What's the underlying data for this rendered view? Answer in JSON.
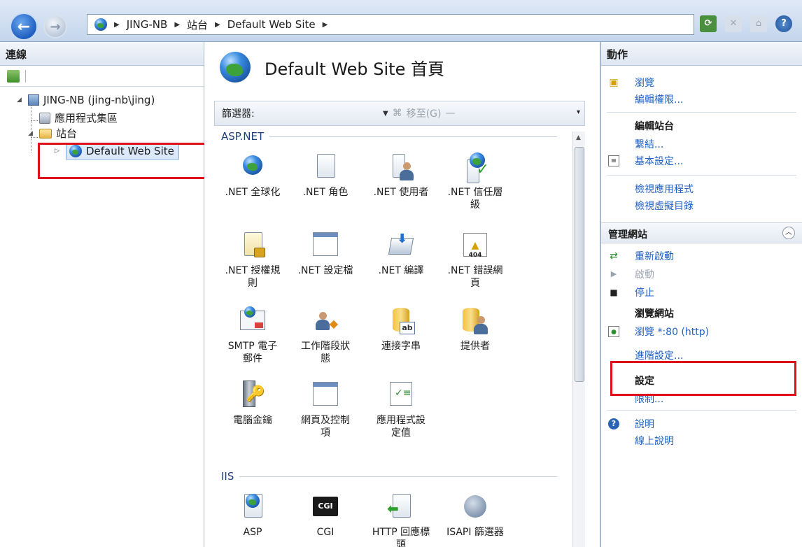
{
  "address_bar": {
    "crumbs": [
      "JING-NB",
      "站台",
      "Default Web Site"
    ]
  },
  "connections": {
    "title": "連線",
    "tree": {
      "server": "JING-NB (jing-nb\\jing)",
      "app_pools": "應用程式集區",
      "sites": "站台",
      "selected_site": "Default Web Site"
    }
  },
  "main": {
    "title": "Default Web Site 首頁",
    "filter_label": "篩選器:",
    "goto_label": "移至(G)",
    "groups": {
      "aspnet": "ASP.NET",
      "iis": "IIS"
    },
    "features": {
      "net_globalization": ".NET 全球化",
      "net_roles": ".NET 角色",
      "net_users": ".NET 使用者",
      "net_trust_a": ".NET 信任層",
      "net_trust_b": "級",
      "net_auth_a": ".NET 授權規",
      "net_auth_b": "則",
      "net_profile": ".NET 設定檔",
      "net_compile": ".NET 編譯",
      "net_error_a": ".NET 錯誤網",
      "net_error_b": "頁",
      "smtp_a": "SMTP 電子",
      "smtp_b": "郵件",
      "session_a": "工作階段狀",
      "session_b": "態",
      "connstr": "連接字串",
      "providers": "提供者",
      "machine_key": "電腦金鑰",
      "pages_a": "網頁及控制",
      "pages_b": "項",
      "appsettings_a": "應用程式設",
      "appsettings_b": "定值",
      "asp": "ASP",
      "cgi": "CGI",
      "cgi_icon_text": "CGI",
      "http_resp_a": "HTTP 回應標",
      "http_resp_b": "頭",
      "isapi": "ISAPI 篩選器",
      "error_icon_text": "404"
    }
  },
  "actions": {
    "title": "動作",
    "browse": "瀏覽",
    "edit_permissions": "編輯權限...",
    "edit_site": "編輯站台",
    "bindings": "繫結...",
    "basic_settings": "基本設定...",
    "view_apps": "檢視應用程式",
    "view_vdirs": "檢視虛擬目錄",
    "manage_site": "管理網站",
    "restart": "重新啟動",
    "start": "啟動",
    "stop": "停止",
    "browse_site": "瀏覽網站",
    "browse_80": "瀏覽 *:80 (http)",
    "advanced_settings": "進階設定...",
    "settings": "設定",
    "limits": "限制...",
    "help": "說明",
    "online_help": "線上說明"
  }
}
